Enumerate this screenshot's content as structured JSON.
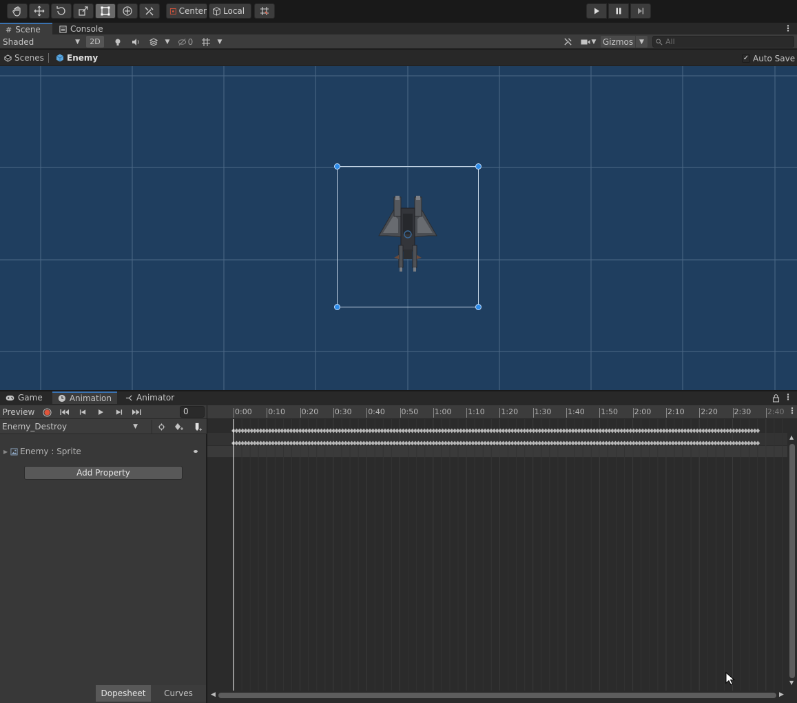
{
  "toolbar": {
    "pivot_label": "Center",
    "space_label": "Local"
  },
  "scene_tabs": {
    "scene": "Scene",
    "console": "Console"
  },
  "scene_bar": {
    "shading": "Shaded",
    "mode_2d": "2D",
    "hidden_count": "0",
    "gizmos": "Gizmos",
    "search_placeholder": "All"
  },
  "breadcrumb": {
    "scenes": "Scenes",
    "prefab": "Enemy",
    "auto_save": "Auto Save"
  },
  "lower_tabs": {
    "game": "Game",
    "animation": "Animation",
    "animator": "Animator"
  },
  "animation": {
    "preview": "Preview",
    "frame": "0",
    "clip": "Enemy_Destroy",
    "property_name": "Enemy : Sprite",
    "add_property": "Add Property",
    "dopesheet": "Dopesheet",
    "curves": "Curves",
    "ruler": [
      "0:00",
      "0:10",
      "0:20",
      "0:30",
      "0:40",
      "0:50",
      "1:00",
      "1:10",
      "1:20",
      "1:30",
      "1:40",
      "1:50",
      "2:00",
      "2:10",
      "2:20",
      "2:30",
      "2:40"
    ]
  },
  "colors": {
    "viewport_bg": "#1f3e5f",
    "accent_blue": "#3a72b0",
    "record_red": "#e0553b"
  }
}
